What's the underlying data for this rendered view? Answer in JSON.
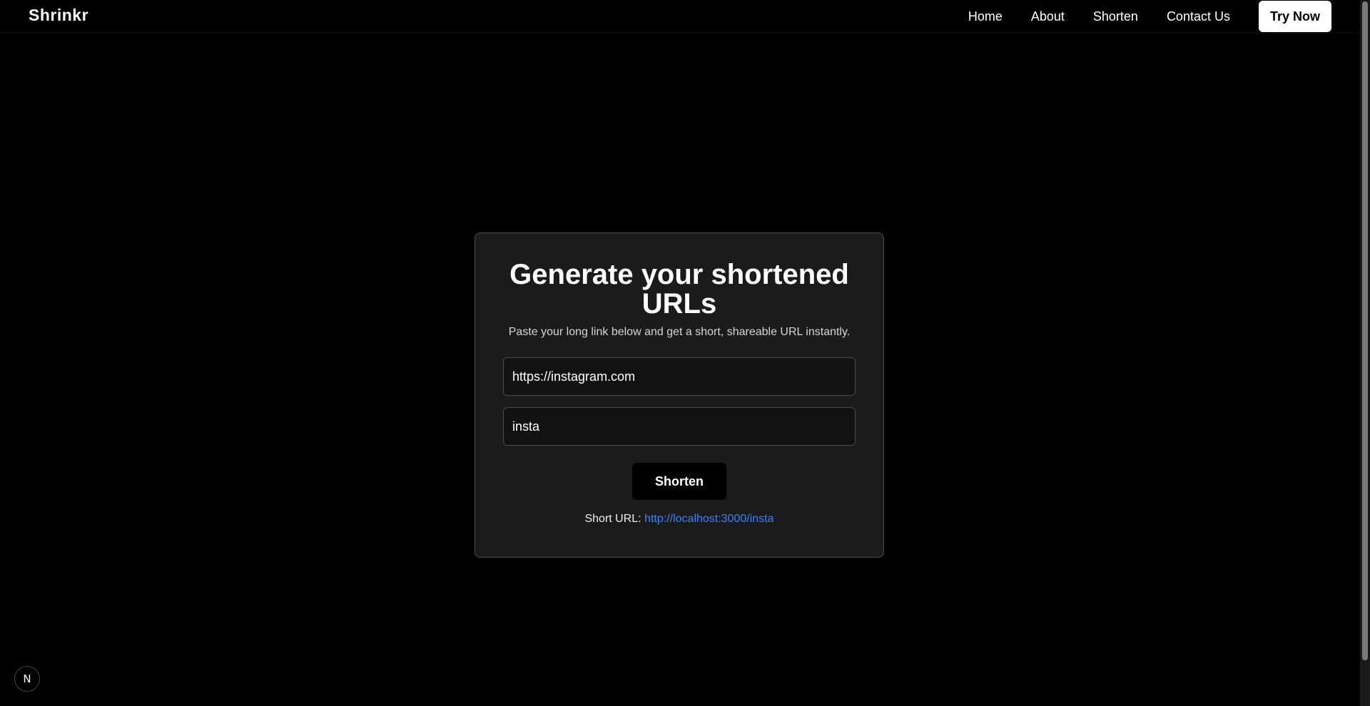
{
  "navbar": {
    "brand": "Shrinkr",
    "links": [
      {
        "label": "Home"
      },
      {
        "label": "About"
      },
      {
        "label": "Shorten"
      },
      {
        "label": "Contact Us"
      }
    ],
    "cta_label": "Try Now"
  },
  "card": {
    "title": "Generate your shortened URLs",
    "subtitle": "Paste your long link below and get a short, shareable URL instantly.",
    "url_input_value": "https://instagram.com",
    "alias_input_value": "insta",
    "shorten_label": "Shorten",
    "result_label": "Short URL:",
    "result_link": "http://localhost:3000/insta"
  },
  "dev_badge": {
    "icon": "nextjs-icon",
    "glyph": "N"
  },
  "colors": {
    "background": "#000000",
    "card_background": "#1b1b1b",
    "link": "#3b82f6"
  }
}
